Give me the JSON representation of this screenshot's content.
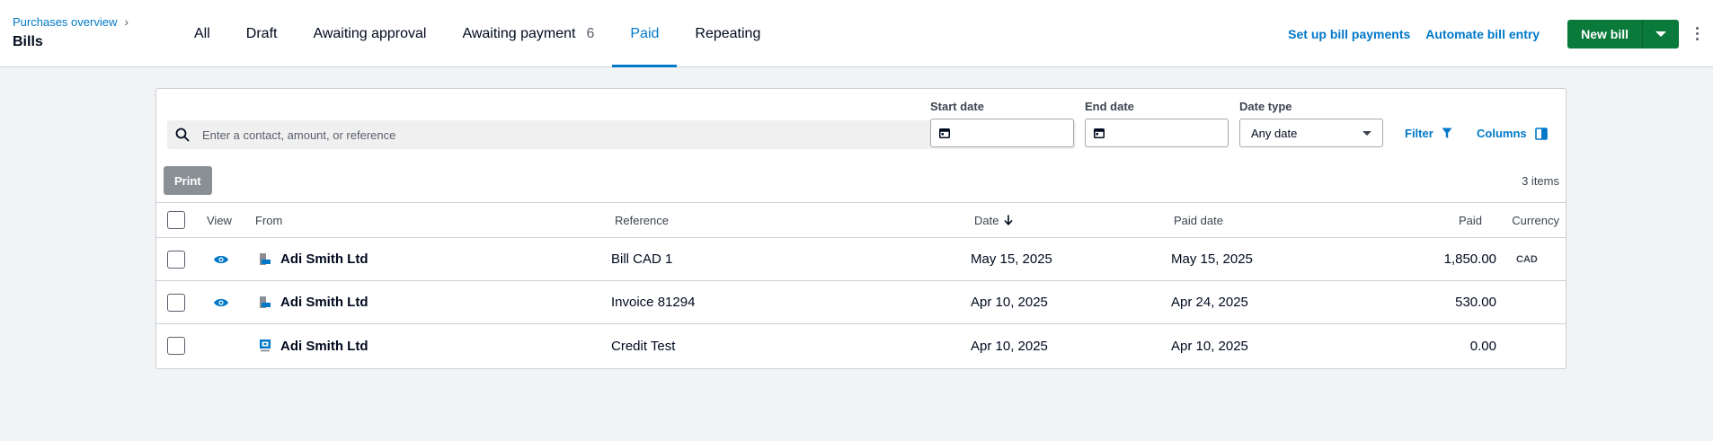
{
  "header": {
    "breadcrumb": "Purchases overview",
    "title": "Bills",
    "tabs": [
      {
        "label": "All"
      },
      {
        "label": "Draft"
      },
      {
        "label": "Awaiting approval"
      },
      {
        "label": "Awaiting payment",
        "count": "6"
      },
      {
        "label": "Paid",
        "active": true
      },
      {
        "label": "Repeating"
      }
    ],
    "actions": {
      "setup_payments": "Set up bill payments",
      "automate_entry": "Automate bill entry",
      "new_bill": "New bill"
    }
  },
  "filters": {
    "search_placeholder": "Enter a contact, amount, or reference",
    "start_date_label": "Start date",
    "end_date_label": "End date",
    "date_type_label": "Date type",
    "date_type_value": "Any date",
    "filter_label": "Filter",
    "columns_label": "Columns"
  },
  "toolbar": {
    "print_label": "Print",
    "items_count": "3 items"
  },
  "table": {
    "columns": {
      "view": "View",
      "from": "From",
      "reference": "Reference",
      "date": "Date",
      "paid_date": "Paid date",
      "paid": "Paid",
      "currency": "Currency"
    },
    "rows": [
      {
        "from": "Adi Smith Ltd",
        "reference": "Bill CAD 1",
        "date": "May 15, 2025",
        "paid_date": "May 15, 2025",
        "paid": "1,850.00",
        "currency": "CAD",
        "has_view": true,
        "icon": "bill-icon"
      },
      {
        "from": "Adi Smith Ltd",
        "reference": "Invoice 81294",
        "date": "Apr 10, 2025",
        "paid_date": "Apr 24, 2025",
        "paid": "530.00",
        "currency": "",
        "has_view": true,
        "icon": "bill-icon"
      },
      {
        "from": "Adi Smith Ltd",
        "reference": "Credit Test",
        "date": "Apr 10, 2025",
        "paid_date": "Apr 10, 2025",
        "paid": "0.00",
        "currency": "",
        "has_view": false,
        "icon": "credit-note-icon"
      }
    ]
  },
  "colors": {
    "accent": "#0078c8",
    "primary_button": "#0a7a3b",
    "background": "#f2f3f4"
  }
}
